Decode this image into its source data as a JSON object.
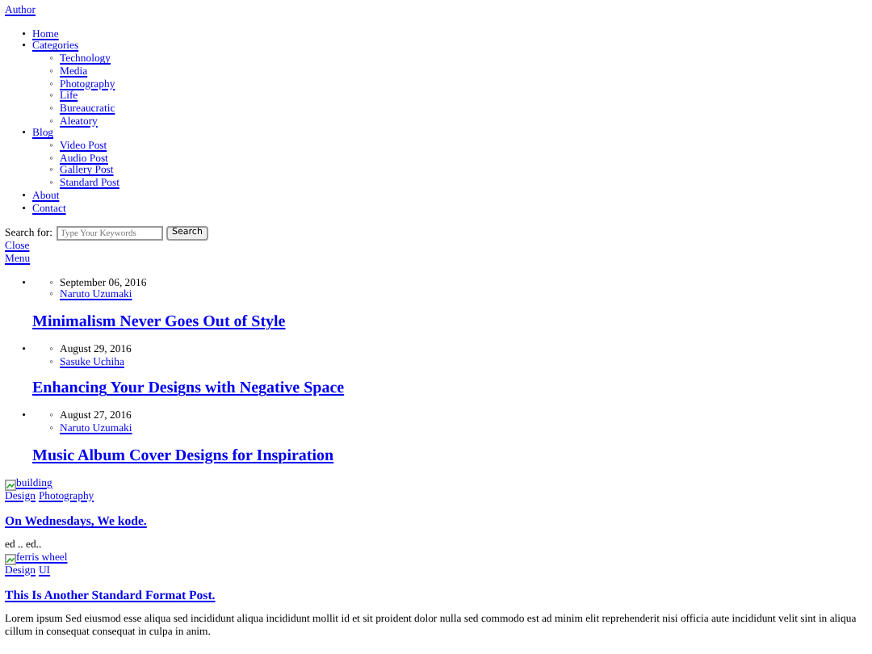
{
  "author_link": "Author",
  "nav": [
    {
      "marker": "•",
      "label": "Home"
    },
    {
      "marker": "•",
      "label": "Categories",
      "children": [
        {
          "marker": "◦",
          "label": "Technology"
        },
        {
          "marker": "◦",
          "label": "Media"
        },
        {
          "marker": "◦",
          "label": "Photography"
        },
        {
          "marker": "◦",
          "label": "Life"
        },
        {
          "marker": "◦",
          "label": "Bureaucratic"
        },
        {
          "marker": "◦",
          "label": "Aleatory"
        }
      ]
    },
    {
      "marker": "•",
      "label": "Blog",
      "children": [
        {
          "marker": "◦",
          "label": "Video Post"
        },
        {
          "marker": "◦",
          "label": "Audio Post"
        },
        {
          "marker": "◦",
          "label": "Gallery Post"
        },
        {
          "marker": "◦",
          "label": "Standard Post"
        }
      ]
    },
    {
      "marker": "•",
      "label": "About"
    },
    {
      "marker": "•",
      "label": "Contact"
    }
  ],
  "search": {
    "label": "Search for:",
    "placeholder": "Type Your Keywords",
    "button": "Search"
  },
  "close_link": "Close",
  "menu_link": "Menu",
  "featured": [
    {
      "marker": "•",
      "date_marker": "◦",
      "date": "September 06, 2016",
      "author_marker": "◦",
      "author": "Naruto Uzumaki",
      "title": "Minimalism Never Goes Out of Style"
    },
    {
      "marker": "•",
      "date_marker": "◦",
      "date": "August 29, 2016",
      "author_marker": "◦",
      "author": "Sasuke Uchiha",
      "title": "Enhancing Your Designs with Negative Space"
    },
    {
      "marker": "•",
      "date_marker": "◦",
      "date": "August 27, 2016",
      "author_marker": "◦",
      "author": "Naruto Uzumaki",
      "title": "Music Album Cover Designs for Inspiration"
    }
  ],
  "posts": [
    {
      "image_alt": "building",
      "categories": [
        "Design",
        "Photography"
      ],
      "title": "On Wednesdays, We kode.",
      "excerpt": "ed .. ed.."
    },
    {
      "image_alt": "ferris wheel",
      "categories": [
        "Design",
        "UI"
      ],
      "title": "This Is Another Standard Format Post.",
      "excerpt": "Lorem ipsum Sed eiusmod esse aliqua sed incididunt aliqua incididunt mollit id et sit proident dolor nulla sed commodo est ad minim elit reprehenderit nisi officia aute incididunt velit sint in aliqua cillum in consequat consequat in culpa in anim."
    }
  ]
}
